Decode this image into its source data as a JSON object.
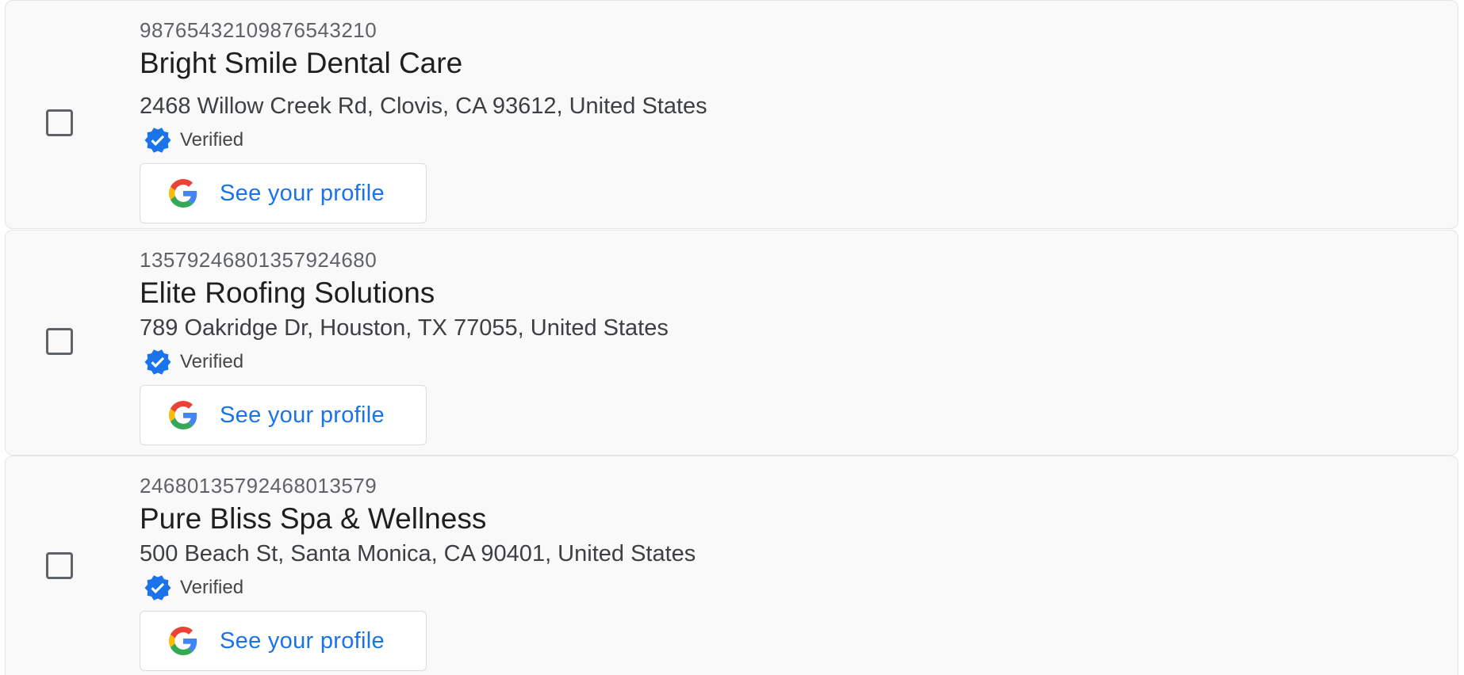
{
  "listings": [
    {
      "store_code": "98765432109876543210",
      "name": "Bright Smile Dental Care",
      "address": "2468 Willow Creek Rd, Clovis, CA 93612, United States",
      "status": "Verified",
      "profile_button": "See your profile",
      "selected": false
    },
    {
      "store_code": "13579246801357924680",
      "name": "Elite Roofing Solutions",
      "address": "789 Oakridge Dr, Houston, TX 77055, United States",
      "status": "Verified",
      "profile_button": "See your profile",
      "selected": false
    },
    {
      "store_code": "24680135792468013579",
      "name": "Pure Bliss Spa & Wellness",
      "address": "500 Beach St, Santa Monica, CA 90401, United States",
      "status": "Verified",
      "profile_button": "See your profile",
      "selected": false
    }
  ],
  "icons": {
    "verified": "verified-badge-icon",
    "profile": "google-g-icon"
  },
  "colors": {
    "link_blue": "#1a73e8",
    "verified_blue": "#1a73e8",
    "card_background": "#f9f9fa",
    "card_border": "#e4e5e7"
  }
}
